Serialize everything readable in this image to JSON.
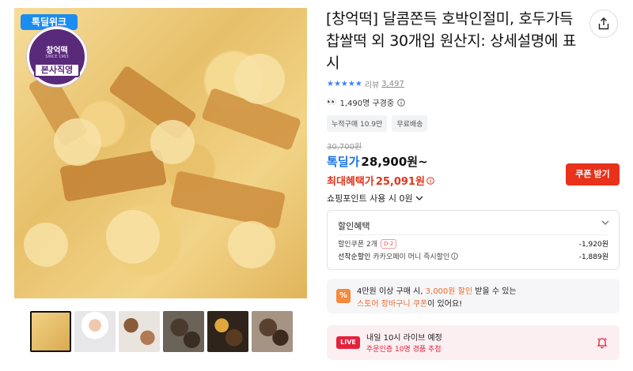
{
  "product": {
    "title": "[창억떡] 달콤쫀득 호박인절미, 호두가득 찹쌀떡 외 30개입 원산지: 상세설명에 표시",
    "brand_badge": "톡딜위크",
    "seal_name": "창억떡",
    "seal_since": "SINCE 1963",
    "seal_ribbon": "본사직영",
    "rating_stars": "★★★★★",
    "review_label": "리뷰",
    "review_count": "3,497",
    "viewers_text": "1,490명 구경중",
    "tags": [
      "누적구매 10.9만",
      "무료배송"
    ],
    "original_price": "30,700원",
    "deal_label": "톡딜가",
    "deal_price": "28,900원~",
    "best_label": "최대혜택가",
    "best_price": "25,091원",
    "coupon_button": "쿠폰 받기",
    "points_text": "쇼핑포인트 사용 시 0원"
  },
  "discount": {
    "title": "할인혜택",
    "row1_label": "할인쿠폰 2개",
    "row1_pill": "D-2",
    "row1_amount": "-1,920원",
    "row2_label": "선착순할인",
    "row2_sub": "카카오페이 머니 즉시할인",
    "row2_amount": "-1,889원"
  },
  "promo": {
    "icon_text": "%",
    "line1_a": "4만원 이상 구매 시, ",
    "line1_hl": "3,000원 할인",
    "line1_b": " 받을 수 있는",
    "line2_hl": "스토어 장바구니 쿠폰",
    "line2_b": "이 있어요!"
  },
  "live": {
    "badge": "LIVE",
    "line1": "내일 10시 라이브 예정",
    "line2": "주문인증 10명 경품 추첨"
  },
  "colors": {
    "deal_blue": "#1a73e8",
    "red": "#e0341b",
    "live_red": "#e5213b",
    "promo_orange": "#ef6b2a"
  }
}
